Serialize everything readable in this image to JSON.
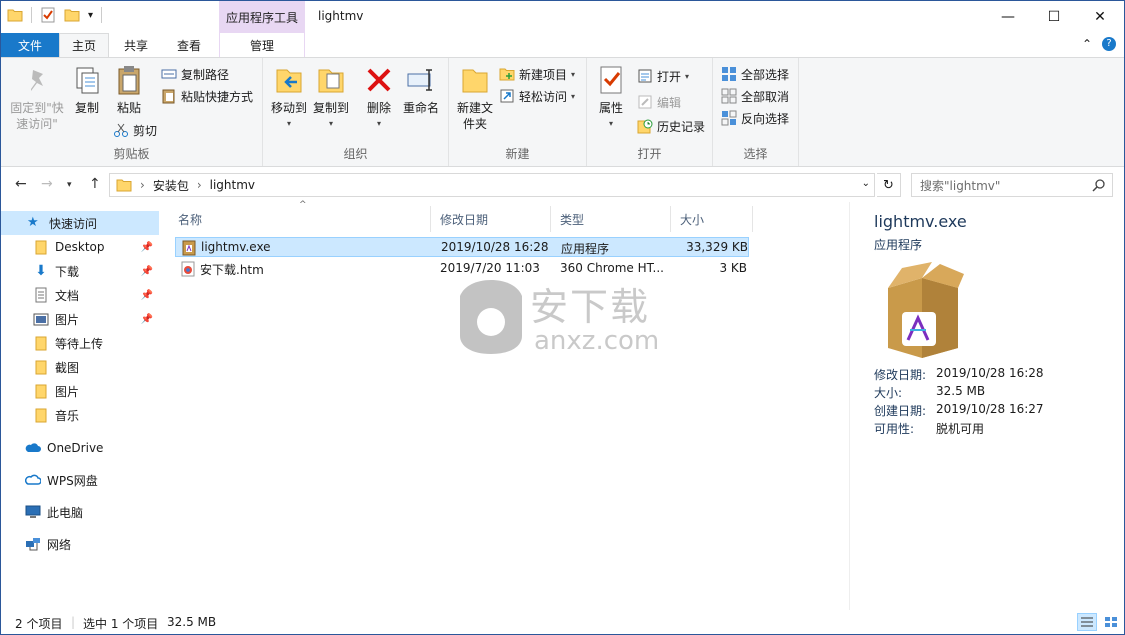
{
  "window": {
    "title": "lightmv",
    "context_tools_label": "应用程序工具"
  },
  "ribbon_tabs": {
    "file": "文件",
    "home": "主页",
    "share": "共享",
    "view": "查看",
    "manage": "管理"
  },
  "ribbon": {
    "clipboard": {
      "label": "剪贴板",
      "pin": "固定到\"快速访问\"",
      "copy": "复制",
      "paste": "粘贴",
      "copy_path": "复制路径",
      "paste_shortcut": "粘贴快捷方式",
      "cut": "剪切"
    },
    "organize": {
      "label": "组织",
      "move_to": "移动到",
      "copy_to": "复制到",
      "delete": "删除",
      "rename": "重命名"
    },
    "new": {
      "label": "新建",
      "new_folder": "新建文件夹",
      "new_item": "新建项目",
      "easy_access": "轻松访问"
    },
    "open": {
      "label": "打开",
      "properties": "属性",
      "open": "打开",
      "edit": "编辑",
      "history": "历史记录"
    },
    "select": {
      "label": "选择",
      "select_all": "全部选择",
      "select_none": "全部取消",
      "invert": "反向选择"
    }
  },
  "address": {
    "segments": [
      "安装包",
      "lightmv"
    ],
    "search_placeholder": "搜索\"lightmv\""
  },
  "nav": {
    "quick_access": "快速访问",
    "items": [
      {
        "label": "Desktop",
        "pinned": true
      },
      {
        "label": "下载",
        "pinned": true
      },
      {
        "label": "文档",
        "pinned": true
      },
      {
        "label": "图片",
        "pinned": true
      },
      {
        "label": "等待上传",
        "pinned": false
      },
      {
        "label": "截图",
        "pinned": false
      },
      {
        "label": "图片",
        "pinned": false
      },
      {
        "label": "音乐",
        "pinned": false
      }
    ],
    "onedrive": "OneDrive",
    "wps": "WPS网盘",
    "this_pc": "此电脑",
    "network": "网络"
  },
  "columns": {
    "name": "名称",
    "modified": "修改日期",
    "type": "类型",
    "size": "大小"
  },
  "files": [
    {
      "name": "lightmv.exe",
      "modified": "2019/10/28 16:28",
      "type": "应用程序",
      "size": "33,329 KB",
      "selected": true
    },
    {
      "name": "安下载.htm",
      "modified": "2019/7/20 11:03",
      "type": "360 Chrome HT...",
      "size": "3 KB",
      "selected": false
    }
  ],
  "watermark": {
    "text_cn": "安下载",
    "text_en": "anxz.com"
  },
  "details": {
    "name": "lightmv.exe",
    "type": "应用程序",
    "props": [
      {
        "label": "修改日期:",
        "value": "2019/10/28 16:28"
      },
      {
        "label": "大小:",
        "value": "32.5 MB"
      },
      {
        "label": "创建日期:",
        "value": "2019/10/28 16:27"
      },
      {
        "label": "可用性:",
        "value": "脱机可用"
      }
    ]
  },
  "status": {
    "count": "2 个项目",
    "selection": "选中 1 个项目",
    "size": "32.5 MB"
  },
  "colors": {
    "accent": "#1979ca",
    "selection": "#cce8ff",
    "context_tab": "#e8d7f3"
  }
}
